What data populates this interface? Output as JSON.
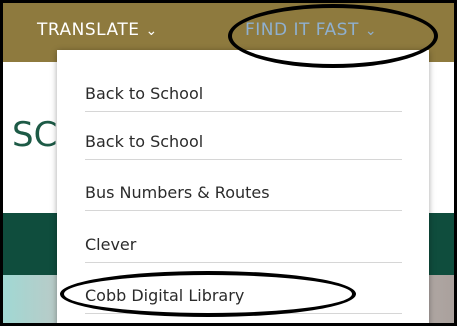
{
  "nav": {
    "translate_label": "TRANSLATE",
    "find_label": "FIND IT FAST"
  },
  "page": {
    "partial_title": "SC"
  },
  "dropdown": {
    "items": [
      {
        "label": "Back to School"
      },
      {
        "label": "Back to School"
      },
      {
        "label": "Bus Numbers & Routes"
      },
      {
        "label": "Clever"
      },
      {
        "label": "Cobb Digital Library"
      }
    ]
  },
  "colors": {
    "topbar": "#8e7a3e",
    "find_it_fast_text": "#8fb0d0",
    "green_band": "#0f4d3d",
    "title_green": "#1d5a46"
  }
}
